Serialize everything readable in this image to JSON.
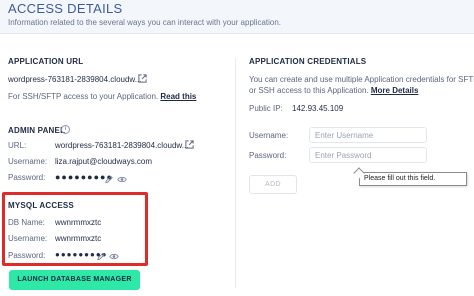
{
  "header": {
    "title": "ACCESS DETAILS",
    "subtitle": "Information related to the several ways you can interact with your application."
  },
  "application_url": {
    "title": "APPLICATION URL",
    "url": "wordpress-763181-2839804.cloudw...",
    "sftp_text": "For SSH/SFTP access to your Application.",
    "read_this": "Read this"
  },
  "admin_panel": {
    "title": "ADMIN PANEL",
    "url_label": "URL:",
    "url_value": "wordpress-763181-2839804.cloudw...",
    "username_label": "Username:",
    "username_value": "liza.rajput@cloudways.com",
    "password_label": "Password:",
    "password_mask": "●●●●●●●●●"
  },
  "mysql": {
    "title": "MYSQL ACCESS",
    "db_label": "DB Name:",
    "db_value": "wwnrmmxztc",
    "username_label": "Username:",
    "username_value": "wwnrmmxztc",
    "password_label": "Password:",
    "password_mask": "●●●●●●●●●"
  },
  "launch_button": "LAUNCH DATABASE MANAGER",
  "credentials": {
    "title": "APPLICATION CREDENTIALS",
    "description_line1": "You can create and use multiple Application credentials for SFTP",
    "description_line2": "or SSH access to this Application.",
    "more_details": "More Details",
    "public_ip_label": "Public IP:",
    "public_ip_value": "142.93.45.109",
    "username_label": "Username:",
    "username_placeholder": "Enter Username",
    "password_label": "Password:",
    "password_placeholder": "Enter Password",
    "add_button": "ADD",
    "tooltip": "Please fill out this field."
  },
  "colors": {
    "accent": "#2ee8a7",
    "header_bg": "#f3f6fb",
    "highlight_border": "#e02b2b",
    "title_blue": "#3d5a9a"
  }
}
